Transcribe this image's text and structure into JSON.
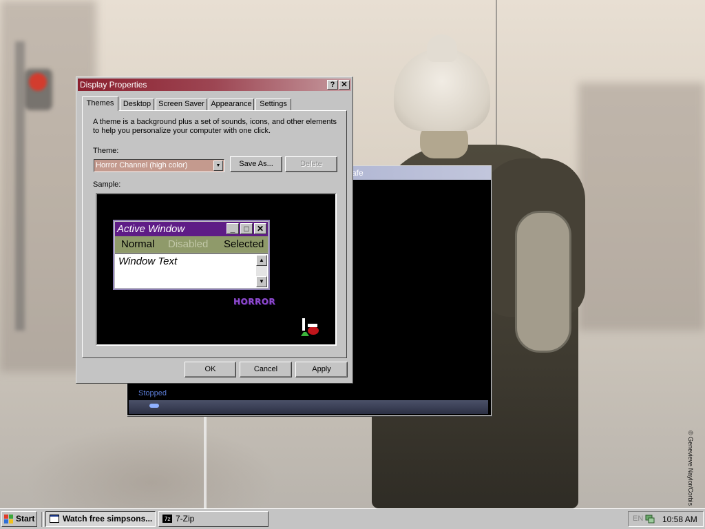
{
  "wallpaper": {
    "credit": "© Genevieve Naylor/Corbis"
  },
  "media_player": {
    "title_visible": "afe",
    "status": "Stopped"
  },
  "dialog": {
    "title": "Display Properties",
    "help_glyph": "?",
    "close_glyph": "✕",
    "tabs": [
      {
        "label": "Themes",
        "active": true
      },
      {
        "label": "Desktop"
      },
      {
        "label": "Screen Saver"
      },
      {
        "label": "Appearance"
      },
      {
        "label": "Settings"
      }
    ],
    "description": "A theme is a background plus a set of sounds, icons, and other elements to help you personalize your computer with one click.",
    "theme_label": "Theme:",
    "theme_value": "Horror Channel (high color)",
    "save_as_label": "Save As...",
    "delete_label": "Delete",
    "sample_label": "Sample:",
    "sample": {
      "title": "Active Window",
      "menu_normal": "Normal",
      "menu_disabled": "Disabled",
      "menu_selected": "Selected",
      "window_text": "Window Text",
      "logo_text": "HORROR",
      "colors": {
        "active_title": "#5e1c86",
        "menu_bar": "#8f9a6a"
      }
    },
    "ok_label": "OK",
    "cancel_label": "Cancel",
    "apply_label": "Apply",
    "title_gradient": [
      "#8b1f2e",
      "#c69ba0"
    ]
  },
  "taskbar": {
    "start_label": "Start",
    "tasks": [
      {
        "label": "Watch free simpsons...",
        "pressed": true,
        "icon": "browser-icon"
      },
      {
        "label": "7-Zip",
        "pressed": false,
        "icon": "7zip-icon"
      }
    ],
    "tray": {
      "language": "EN",
      "clock": "10:58 AM"
    }
  }
}
